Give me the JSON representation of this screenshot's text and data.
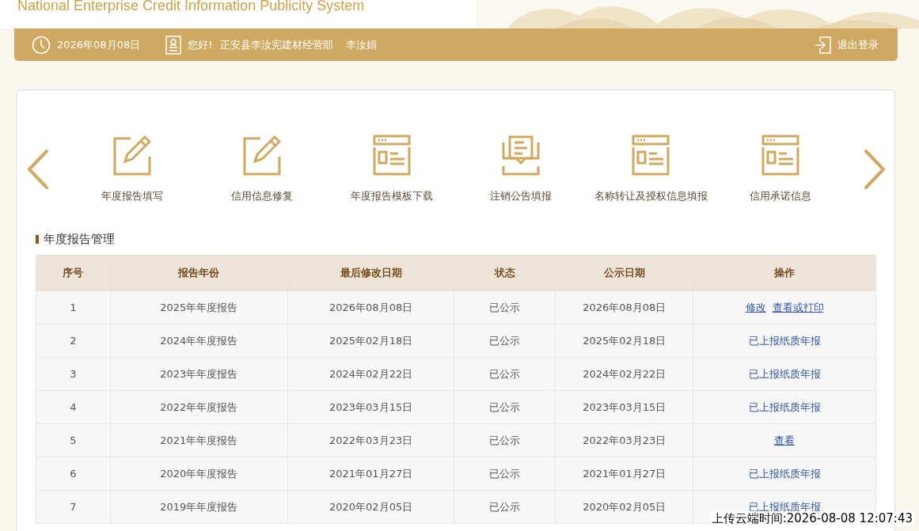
{
  "header": {
    "title": "National Enterprise Credit Information Publicity System"
  },
  "user_bar": {
    "date": "2026年08月08日",
    "greeting": "您好!",
    "company": "正安县李汝宪建材经营部",
    "person": "李汝娟",
    "logout": "退出登录"
  },
  "shortcuts": [
    {
      "label": "年度报告填写",
      "kind": "edit"
    },
    {
      "label": "信用信息修复",
      "kind": "edit"
    },
    {
      "label": "年度报告模板下载",
      "kind": "page"
    },
    {
      "label": "注销公告填报",
      "kind": "inbox"
    },
    {
      "label": "名称转让及授权信息填报",
      "kind": "page"
    },
    {
      "label": "信用承诺信息",
      "kind": "page"
    }
  ],
  "section_title": "年度报告管理",
  "table": {
    "columns": [
      "序号",
      "报告年份",
      "最后修改日期",
      "状态",
      "公示日期",
      "操作"
    ],
    "rows": [
      {
        "cells": [
          "1",
          "2025年年度报告",
          "2026年08月08日",
          "已公示",
          "2026年08月08日"
        ],
        "actions": [
          {
            "label": "修改",
            "kind": "link"
          },
          {
            "label": "查看或打印",
            "kind": "link"
          }
        ]
      },
      {
        "cells": [
          "2",
          "2024年年度报告",
          "2025年02月18日",
          "已公示",
          "2025年02月18日"
        ],
        "actions": [
          {
            "label": "已上报纸质年报",
            "kind": "text"
          }
        ]
      },
      {
        "cells": [
          "3",
          "2023年年度报告",
          "2024年02月22日",
          "已公示",
          "2024年02月22日"
        ],
        "actions": [
          {
            "label": "已上报纸质年报",
            "kind": "text"
          }
        ]
      },
      {
        "cells": [
          "4",
          "2022年年度报告",
          "2023年03月15日",
          "已公示",
          "2023年03月15日"
        ],
        "actions": [
          {
            "label": "已上报纸质年报",
            "kind": "text"
          }
        ]
      },
      {
        "cells": [
          "5",
          "2021年年度报告",
          "2022年03月23日",
          "已公示",
          "2022年03月23日"
        ],
        "actions": [
          {
            "label": "查看",
            "kind": "link"
          }
        ]
      },
      {
        "cells": [
          "6",
          "2020年年度报告",
          "2021年01月27日",
          "已公示",
          "2021年01月27日"
        ],
        "actions": [
          {
            "label": "已上报纸质年报",
            "kind": "text"
          }
        ]
      },
      {
        "cells": [
          "7",
          "2019年年度报告",
          "2020年02月05日",
          "已公示",
          "2020年02月05日"
        ],
        "actions": [
          {
            "label": "已上报纸质年报",
            "kind": "text"
          }
        ]
      }
    ]
  },
  "upload_time": "上传云端时间:2026-08-08 12:07:43"
}
